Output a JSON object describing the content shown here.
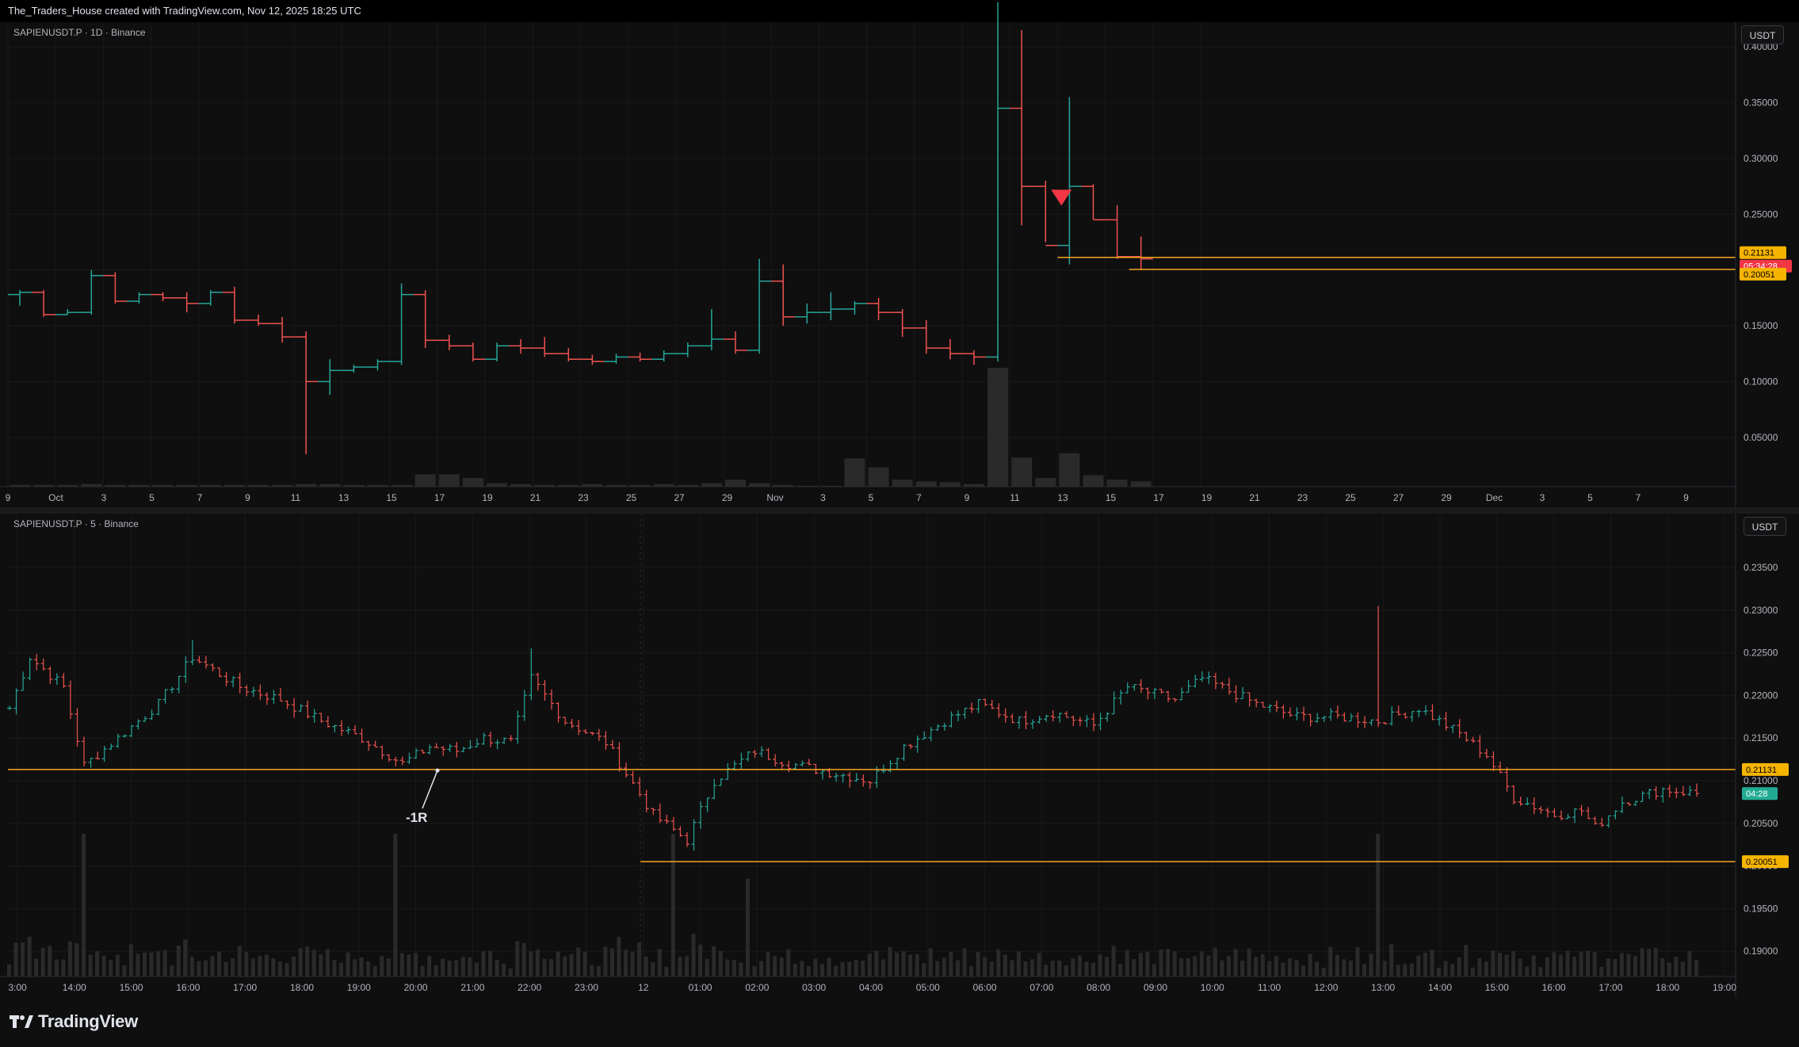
{
  "header": {
    "text": "The_Traders_House created with TradingView.com, Nov 12, 2025 18:25 UTC"
  },
  "top_pane": {
    "title": "SAPIENUSDT.P · 1D · Binance",
    "currency_button": "USDT",
    "price_ticks": [
      "0.40000",
      "0.35000",
      "0.30000",
      "0.25000",
      "0.15000",
      "0.10000",
      "0.05000"
    ],
    "date_ticks": [
      "9",
      "Oct",
      "3",
      "5",
      "7",
      "9",
      "11",
      "13",
      "15",
      "17",
      "19",
      "21",
      "23",
      "25",
      "27",
      "29",
      "Nov",
      "3",
      "5",
      "7",
      "9",
      "11",
      "13",
      "15",
      "17",
      "19",
      "21",
      "23",
      "25",
      "27",
      "29",
      "Dec",
      "3",
      "5",
      "7",
      "9"
    ],
    "level_labels": {
      "upper": "0.21131",
      "countdown": "05:34:28",
      "lower": "0.20051"
    },
    "volume_note": "volume bars at bottom"
  },
  "bottom_pane": {
    "title": "SAPIENUSDT.P · 5 · Binance",
    "currency_button": "USDT",
    "price_ticks": [
      "0.23500",
      "0.23000",
      "0.22500",
      "0.22000",
      "0.21500",
      "0.21000",
      "0.20500",
      "0.20000",
      "0.19500",
      "0.19000"
    ],
    "time_ticks": [
      "3:00",
      "14:00",
      "15:00",
      "16:00",
      "17:00",
      "18:00",
      "19:00",
      "20:00",
      "21:00",
      "22:00",
      "23:00",
      "12",
      "01:00",
      "02:00",
      "03:00",
      "04:00",
      "05:00",
      "06:00",
      "07:00",
      "08:00",
      "09:00",
      "10:00",
      "11:00",
      "12:00",
      "13:00",
      "14:00",
      "15:00",
      "16:00",
      "17:00",
      "18:00",
      "19:00"
    ],
    "level_labels": {
      "upper": "0.21131",
      "countdown": "04:28",
      "lower": "0.20051"
    },
    "annotation": "-1R"
  },
  "footer": {
    "brand": "TradingView"
  },
  "colors": {
    "background": "#0f0f0f",
    "up": "#26a69a",
    "down": "#ef5350",
    "level_line": "#f5a623",
    "level_label_bg": "#f5b400",
    "countdown_top_bg": "#f23645",
    "countdown_bottom_bg": "#22ab94",
    "sell_marker": "#f23645",
    "volume": "#2a2a2a"
  },
  "chart_data": [
    {
      "type": "ohlc",
      "title": "SAPIENUSDT.P · 1D · Binance",
      "ylim": [
        0.02,
        0.42
      ],
      "levels": [
        0.21131,
        0.20051
      ],
      "signal": {
        "type": "sell-triangle",
        "bar_index": 43
      },
      "bars": [
        [
          0.178,
          0.182,
          0.168,
          0.18
        ],
        [
          0.18,
          0.182,
          0.158,
          0.16
        ],
        [
          0.16,
          0.165,
          0.16,
          0.162
        ],
        [
          0.162,
          0.2,
          0.16,
          0.195
        ],
        [
          0.195,
          0.198,
          0.17,
          0.172
        ],
        [
          0.172,
          0.18,
          0.17,
          0.178
        ],
        [
          0.178,
          0.18,
          0.172,
          0.175
        ],
        [
          0.175,
          0.18,
          0.162,
          0.17
        ],
        [
          0.17,
          0.182,
          0.168,
          0.18
        ],
        [
          0.18,
          0.185,
          0.152,
          0.155
        ],
        [
          0.155,
          0.16,
          0.15,
          0.152
        ],
        [
          0.152,
          0.158,
          0.135,
          0.14
        ],
        [
          0.14,
          0.145,
          0.035,
          0.1
        ],
        [
          0.1,
          0.12,
          0.088,
          0.11
        ],
        [
          0.11,
          0.115,
          0.108,
          0.113
        ],
        [
          0.113,
          0.12,
          0.11,
          0.118
        ],
        [
          0.118,
          0.188,
          0.115,
          0.178
        ],
        [
          0.178,
          0.182,
          0.13,
          0.137
        ],
        [
          0.137,
          0.142,
          0.128,
          0.132
        ],
        [
          0.132,
          0.135,
          0.118,
          0.12
        ],
        [
          0.12,
          0.135,
          0.118,
          0.132
        ],
        [
          0.132,
          0.138,
          0.125,
          0.13
        ],
        [
          0.13,
          0.14,
          0.122,
          0.125
        ],
        [
          0.125,
          0.13,
          0.118,
          0.12
        ],
        [
          0.12,
          0.124,
          0.115,
          0.118
        ],
        [
          0.118,
          0.125,
          0.116,
          0.122
        ],
        [
          0.122,
          0.126,
          0.118,
          0.12
        ],
        [
          0.12,
          0.128,
          0.118,
          0.125
        ],
        [
          0.125,
          0.135,
          0.122,
          0.132
        ],
        [
          0.132,
          0.165,
          0.128,
          0.138
        ],
        [
          0.138,
          0.145,
          0.125,
          0.128
        ],
        [
          0.128,
          0.21,
          0.125,
          0.19
        ],
        [
          0.19,
          0.205,
          0.15,
          0.158
        ],
        [
          0.158,
          0.17,
          0.152,
          0.162
        ],
        [
          0.162,
          0.18,
          0.155,
          0.165
        ],
        [
          0.165,
          0.172,
          0.16,
          0.17
        ],
        [
          0.17,
          0.175,
          0.155,
          0.162
        ],
        [
          0.162,
          0.165,
          0.14,
          0.148
        ],
        [
          0.148,
          0.155,
          0.125,
          0.13
        ],
        [
          0.13,
          0.138,
          0.12,
          0.125
        ],
        [
          0.125,
          0.128,
          0.115,
          0.122
        ],
        [
          0.122,
          0.44,
          0.118,
          0.345
        ],
        [
          0.345,
          0.415,
          0.24,
          0.275
        ],
        [
          0.275,
          0.28,
          0.225,
          0.222
        ],
        [
          0.222,
          0.355,
          0.205,
          0.275
        ],
        [
          0.275,
          0.277,
          0.245,
          0.245
        ],
        [
          0.245,
          0.258,
          0.21,
          0.212
        ],
        [
          0.212,
          0.23,
          0.2,
          0.21
        ]
      ],
      "volume": [
        2,
        2,
        2,
        3,
        2,
        2,
        2,
        2,
        2,
        2,
        2,
        2,
        3,
        3,
        2,
        2,
        2,
        14,
        14,
        10,
        4,
        3,
        2,
        2,
        3,
        2,
        2,
        3,
        2,
        4,
        8,
        4,
        2,
        1,
        1,
        32,
        22,
        8,
        6,
        5,
        3,
        135,
        33,
        10,
        38,
        13,
        8,
        6
      ]
    },
    {
      "type": "ohlc",
      "title": "SAPIENUSDT.P · 5 · Binance",
      "ylim": [
        0.1875,
        0.2395
      ],
      "levels": [
        0.21131,
        0.20051
      ],
      "annotation": {
        "text": "-1R",
        "price": 0.2112
      },
      "anchors": [
        [
          0,
          0.2185
        ],
        [
          3,
          0.2245
        ],
        [
          8,
          0.221
        ],
        [
          11,
          0.2118
        ],
        [
          16,
          0.215
        ],
        [
          22,
          0.219
        ],
        [
          27,
          0.2245
        ],
        [
          34,
          0.221
        ],
        [
          40,
          0.2195
        ],
        [
          46,
          0.217
        ],
        [
          52,
          0.215
        ],
        [
          58,
          0.212
        ],
        [
          62,
          0.214
        ],
        [
          66,
          0.2135
        ],
        [
          70,
          0.215
        ],
        [
          74,
          0.2145
        ],
        [
          77,
          0.222
        ],
        [
          82,
          0.217
        ],
        [
          88,
          0.2145
        ],
        [
          95,
          0.206
        ],
        [
          100,
          0.203
        ],
        [
          104,
          0.21
        ],
        [
          110,
          0.2135
        ],
        [
          115,
          0.212
        ],
        [
          121,
          0.211
        ],
        [
          127,
          0.21
        ],
        [
          132,
          0.214
        ],
        [
          138,
          0.217
        ],
        [
          143,
          0.219
        ],
        [
          149,
          0.217
        ],
        [
          154,
          0.218
        ],
        [
          160,
          0.2165
        ],
        [
          165,
          0.221
        ],
        [
          172,
          0.2195
        ],
        [
          176,
          0.222
        ],
        [
          184,
          0.219
        ],
        [
          190,
          0.2175
        ],
        [
          196,
          0.2175
        ],
        [
          202,
          0.217
        ],
        [
          208,
          0.2185
        ],
        [
          214,
          0.2155
        ],
        [
          218,
          0.213
        ],
        [
          222,
          0.208
        ],
        [
          228,
          0.206
        ],
        [
          232,
          0.2065
        ],
        [
          234,
          0.2045
        ],
        [
          238,
          0.2075
        ],
        [
          244,
          0.209
        ],
        [
          249,
          0.2085
        ]
      ],
      "volume_spikes": [
        [
          11,
          4
        ],
        [
          57,
          9
        ],
        [
          98,
          8
        ],
        [
          109,
          5
        ],
        [
          202,
          20
        ]
      ]
    }
  ]
}
